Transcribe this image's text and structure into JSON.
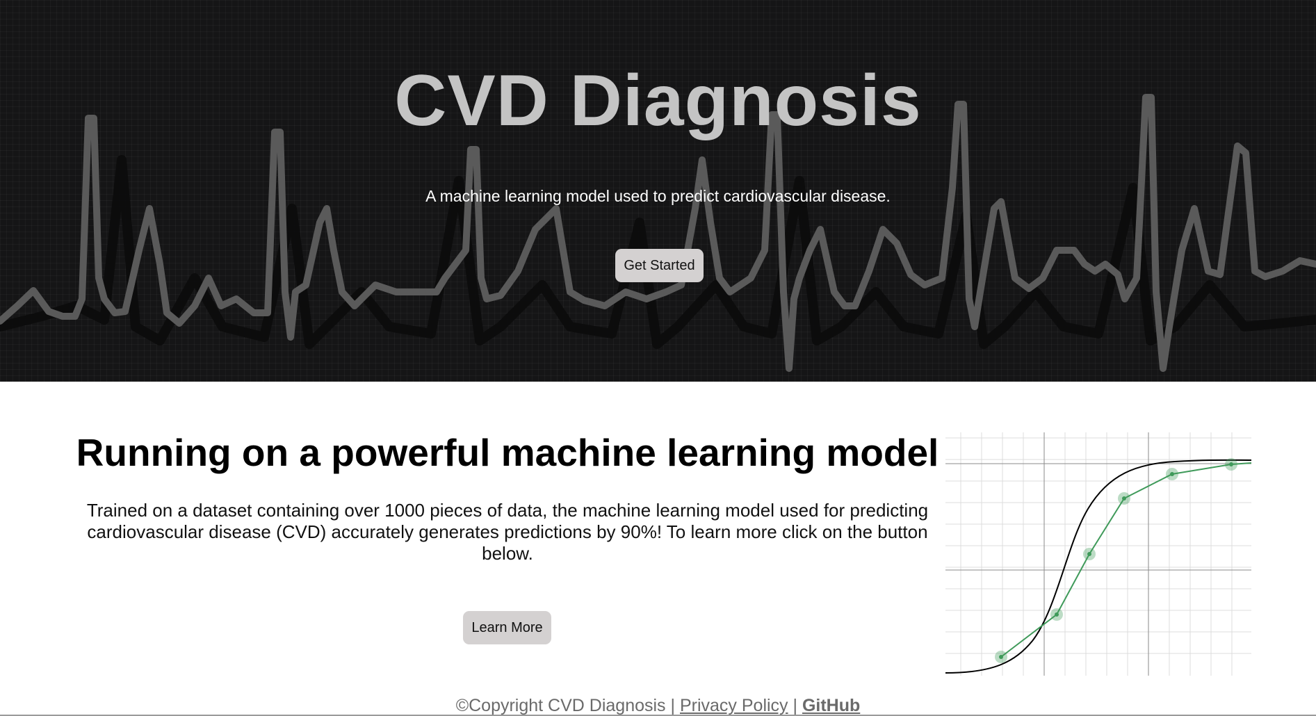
{
  "hero": {
    "title": "CVD Diagnosis",
    "subtitle": "A machine learning model used to predict cardiovascular disease.",
    "cta_label": "Get Started",
    "background_icon": "ecg-waveform-icon"
  },
  "feature": {
    "title": "Running on a powerful machine learning model",
    "body": "Trained on a dataset containing over 1000 pieces of data, the machine learning model used for predicting cardiovascular disease (CVD) accurately generates predictions by 90%! To learn more click on the button below.",
    "cta_label": "Learn More",
    "illustration_icon": "sigmoid-curve-illustration"
  },
  "footer": {
    "copyright": "©Copyright CVD Diagnosis",
    "separator": "|",
    "privacy_label": "Privacy Policy",
    "github_label": "GitHub"
  },
  "colors": {
    "hero_background": "#151516",
    "hero_title": "#c4c4c4",
    "button_background": "#d4d1d1",
    "footer_text": "#6a6a6a",
    "curve_points": "#3f9a5a"
  }
}
